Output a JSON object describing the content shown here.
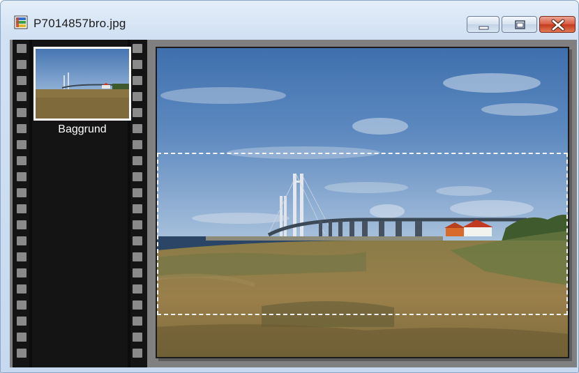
{
  "window": {
    "title": "P7014857bro.jpg",
    "icon": "image-file-icon",
    "controls": {
      "minimize": "minimize-icon",
      "maximize": "maximize-icon",
      "close": "close-icon"
    }
  },
  "layers": [
    {
      "name": "Baggrund",
      "selected": true
    }
  ],
  "canvas": {
    "image_description_icon": "photo-canvas",
    "selection": "marquee-selection"
  },
  "colors": {
    "close_button": "#c9482a",
    "filmstrip": "#141414",
    "workspace": "#808080",
    "sky": "#4f7fb6",
    "field": "#8e7a46"
  }
}
